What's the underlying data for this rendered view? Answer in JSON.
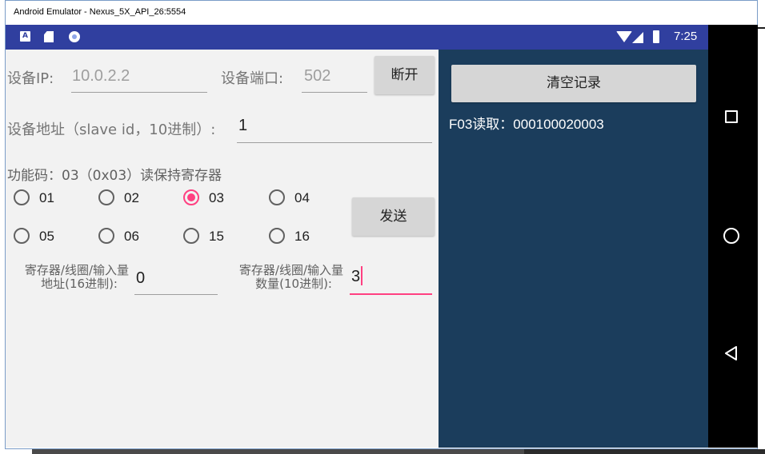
{
  "window": {
    "title": "Android Emulator - Nexus_5X_API_26:5554"
  },
  "statusbar": {
    "time": "7:25",
    "icons": [
      "a-notification-icon",
      "sd-card-icon",
      "sync-circle-icon",
      "wifi-icon",
      "signal-icon",
      "battery-icon"
    ]
  },
  "device": {
    "ip_label": "设备IP:",
    "ip_value": "10.0.2.2",
    "port_label": "设备端口:",
    "port_value": "502",
    "disconnect_label": "断开",
    "address_label": "设备地址（slave id，10进制）:",
    "address_value": "1"
  },
  "function": {
    "label": "功能码：03（0x03）读保持寄存器",
    "options": [
      "01",
      "02",
      "03",
      "04",
      "05",
      "06",
      "15",
      "16"
    ],
    "selected": "03",
    "send_label": "发送"
  },
  "register": {
    "addr_label_line1": "寄存器/线圈/输入量",
    "addr_label_line2": "地址(16进制):",
    "addr_value": "0",
    "count_label_line1": "寄存器/线圈/输入量",
    "count_label_line2": "数量(10进制):",
    "count_value": "3"
  },
  "log": {
    "clear_label": "清空记录",
    "entries": [
      "F03读取：000100020003"
    ]
  },
  "colors": {
    "statusbar": "#303f9f",
    "accent": "#ff4081",
    "log_panel": "#1b3d5c"
  }
}
